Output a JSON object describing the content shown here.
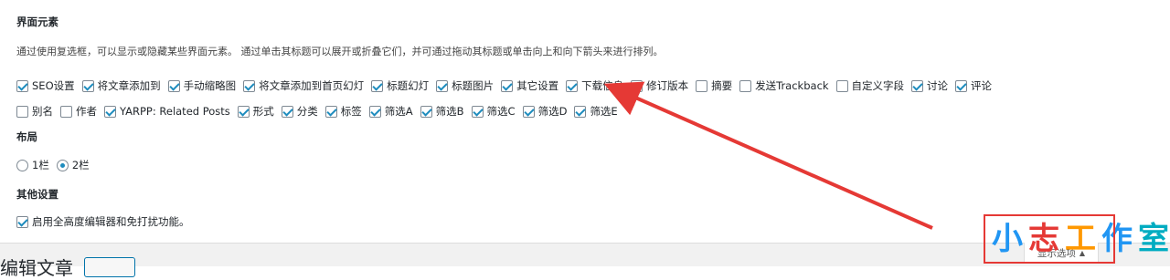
{
  "sections": {
    "interface_title": "界面元素",
    "interface_desc": "通过使用复选框，可以显示或隐藏某些界面元素。 通过单击其标题可以展开或折叠它们，并可通过拖动其标题或单击向上和向下箭头来进行排列。",
    "layout_title": "布局",
    "other_title": "其他设置"
  },
  "options_row1": [
    {
      "label": "SEO设置",
      "checked": true
    },
    {
      "label": "将文章添加到",
      "checked": true
    },
    {
      "label": "手动缩略图",
      "checked": true
    },
    {
      "label": "将文章添加到首页幻灯",
      "checked": true
    },
    {
      "label": "标题幻灯",
      "checked": true
    },
    {
      "label": "标题图片",
      "checked": true
    },
    {
      "label": "其它设置",
      "checked": true
    },
    {
      "label": "下载信息",
      "checked": true
    },
    {
      "label": "修订版本",
      "checked": true
    },
    {
      "label": "摘要",
      "checked": false
    },
    {
      "label": "发送Trackback",
      "checked": false
    },
    {
      "label": "自定义字段",
      "checked": false
    },
    {
      "label": "讨论",
      "checked": true
    },
    {
      "label": "评论",
      "checked": true
    }
  ],
  "options_row2": [
    {
      "label": "别名",
      "checked": false
    },
    {
      "label": "作者",
      "checked": false
    },
    {
      "label": "YARPP: Related Posts",
      "checked": true
    },
    {
      "label": "形式",
      "checked": true
    },
    {
      "label": "分类",
      "checked": true
    },
    {
      "label": "标签",
      "checked": true
    },
    {
      "label": "筛选A",
      "checked": true
    },
    {
      "label": "筛选B",
      "checked": true
    },
    {
      "label": "筛选C",
      "checked": true
    },
    {
      "label": "筛选D",
      "checked": true
    },
    {
      "label": "筛选E",
      "checked": true
    }
  ],
  "layout": {
    "col1_label": "1栏",
    "col2_label": "2栏",
    "selected": "2栏"
  },
  "other": {
    "fullheight_label": "启用全高度编辑器和免打扰功能。",
    "fullheight_checked": true
  },
  "bottom": {
    "edit_title": "编辑文章",
    "screen_options": "显示选项",
    "screen_options_arrow": "▲"
  },
  "watermark": [
    "小",
    "志",
    "工",
    "作",
    "室"
  ],
  "colors": {
    "accent": "#1e8cbe",
    "annotation": "#e53935"
  }
}
